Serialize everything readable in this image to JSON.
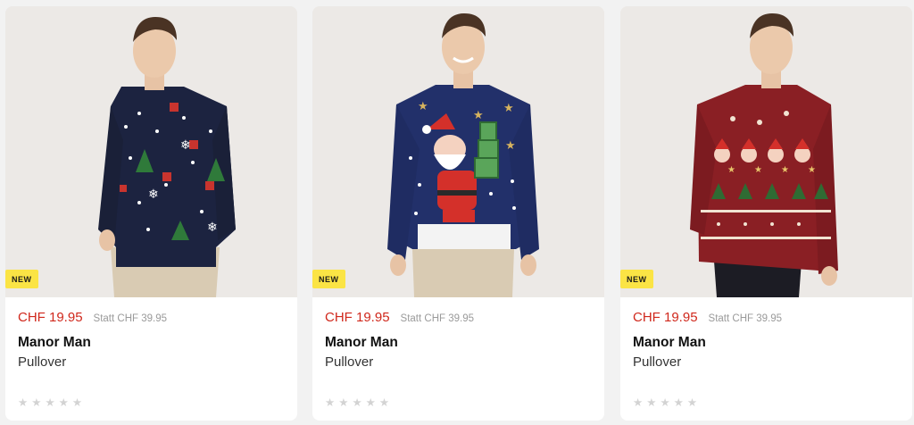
{
  "products": [
    {
      "badge": "NEW",
      "price": "CHF 19.95",
      "old_price": "Statt CHF 39.95",
      "brand": "Manor Man",
      "name": "Pullover",
      "rating_stars": [
        "★",
        "★",
        "★",
        "★",
        "★"
      ],
      "image_icon": "navy-christmas-pullover-image"
    },
    {
      "badge": "NEW",
      "price": "CHF 19.95",
      "old_price": "Statt CHF 39.95",
      "brand": "Manor Man",
      "name": "Pullover",
      "rating_stars": [
        "★",
        "★",
        "★",
        "★",
        "★"
      ],
      "image_icon": "santa-christmas-pullover-image"
    },
    {
      "badge": "NEW",
      "price": "CHF 19.95",
      "old_price": "Statt CHF 39.95",
      "brand": "Manor Man",
      "name": "Pullover",
      "rating_stars": [
        "★",
        "★",
        "★",
        "★",
        "★"
      ],
      "image_icon": "red-christmas-pullover-image"
    }
  ],
  "colors": {
    "price": "#d0281c",
    "old_price": "#9a9a9a",
    "badge_bg": "#fbe445",
    "star_empty": "#d3d3d3"
  }
}
